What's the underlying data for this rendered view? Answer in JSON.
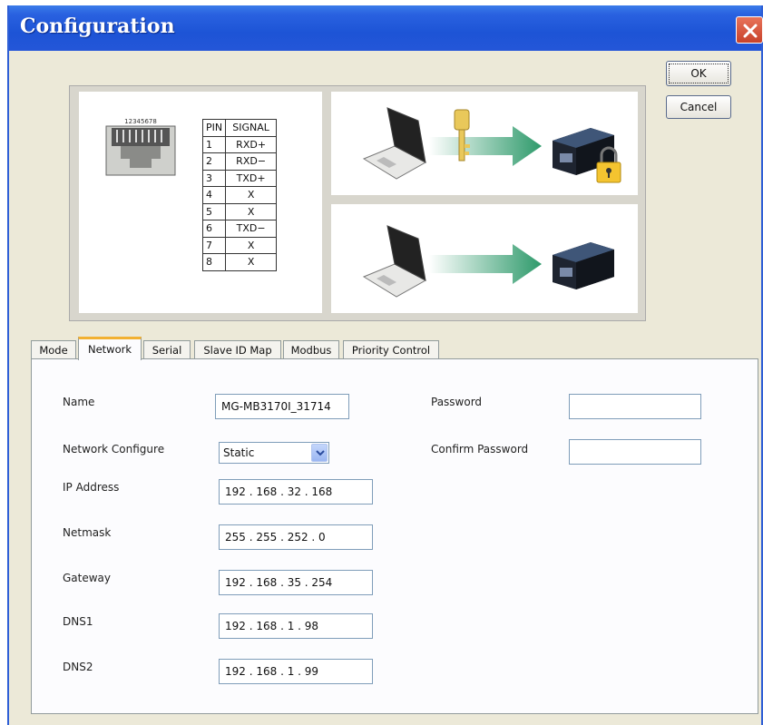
{
  "window": {
    "title": "Configuration",
    "ok_label": "OK",
    "cancel_label": "Cancel"
  },
  "pinout": {
    "jack_numbers": "12345678",
    "headers": [
      "PIN",
      "SIGNAL"
    ],
    "rows": [
      [
        "1",
        "RXD+"
      ],
      [
        "2",
        "RXD−"
      ],
      [
        "3",
        "TXD+"
      ],
      [
        "4",
        "X"
      ],
      [
        "5",
        "X"
      ],
      [
        "6",
        "TXD−"
      ],
      [
        "7",
        "X"
      ],
      [
        "8",
        "X"
      ]
    ]
  },
  "tabs": [
    "Mode",
    "Network",
    "Serial",
    "Slave ID Map",
    "Modbus",
    "Priority Control"
  ],
  "active_tab": "Network",
  "network": {
    "name_label": "Name",
    "name_value": "MG-MB3170I_31714",
    "network_configure_label": "Network Configure",
    "network_configure_value": "Static",
    "ip_label": "IP Address",
    "ip_value": "192 . 168 . 32 . 168",
    "netmask_label": "Netmask",
    "netmask_value": "255 . 255 . 252 . 0",
    "gateway_label": "Gateway",
    "gateway_value": "192 . 168 . 35 . 254",
    "dns1_label": "DNS1",
    "dns1_value": "192 . 168 . 1 . 98",
    "dns2_label": "DNS2",
    "dns2_value": "192 . 168 . 1 . 99",
    "password_label": "Password",
    "password_value": "",
    "confirm_password_label": "Confirm Password",
    "confirm_password_value": ""
  },
  "icons": {
    "close": "close-icon",
    "dropdown": "chevron-down-icon",
    "rj45": "rj45-jack-icon",
    "laptop": "laptop-icon",
    "key": "key-icon",
    "arrow": "arrow-right-icon",
    "device": "device-server-icon",
    "lock": "padlock-icon"
  },
  "colors": {
    "titlebar": "#2456d8",
    "dialog_bg": "#ece9d8",
    "active_tab_accent": "#f2b133",
    "arrow": "#2e9a6b"
  }
}
